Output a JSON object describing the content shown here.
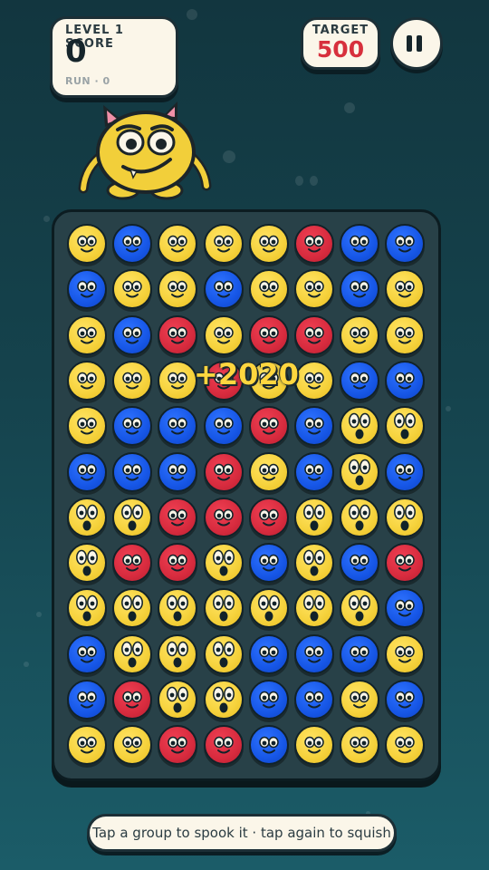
{
  "hud": {
    "score_label": "LEVEL 1 SCORE",
    "score": "0",
    "run": "RUN · 0",
    "target_label": "TARGET",
    "target": "500",
    "pause_icon": "pause-icon"
  },
  "popup": "+2020",
  "hint": "Tap a group to spook it · tap again to squish",
  "colors": {
    "yellow": "#f6d33e",
    "blue": "#1656e6",
    "red": "#d72b3e",
    "board": "#284148",
    "panel": "#fbf6e9",
    "target": "#d72b3e"
  },
  "board": {
    "rows": [
      [
        "Y",
        "B",
        "Y",
        "Y",
        "Y",
        "R",
        "B",
        "B"
      ],
      [
        "B",
        "Y",
        "Y",
        "B",
        "Y",
        "Y",
        "B",
        "Y"
      ],
      [
        "Y",
        "B",
        "R",
        "Y",
        "R",
        "R",
        "Y",
        "Y"
      ],
      [
        "Y",
        "Y",
        "Y",
        "R",
        "Y",
        "Y",
        "B",
        "B"
      ],
      [
        "Y",
        "B",
        "B",
        "B",
        "R",
        "B",
        "Ys",
        "Ys"
      ],
      [
        "B",
        "B",
        "B",
        "R",
        "Y",
        "B",
        "Ys",
        "B"
      ],
      [
        "Ys",
        "Ys",
        "R",
        "R",
        "R",
        "Ys",
        "Ys",
        "Ys"
      ],
      [
        "Ys",
        "R",
        "R",
        "Ys",
        "B",
        "Ys",
        "B",
        "R"
      ],
      [
        "Ys",
        "Ys",
        "Ys",
        "Ys",
        "Ys",
        "Ys",
        "Ys",
        "B"
      ],
      [
        "B",
        "Ys",
        "Ys",
        "Ys",
        "B",
        "B",
        "B",
        "Y"
      ],
      [
        "B",
        "R",
        "Ys",
        "Ys",
        "B",
        "B",
        "Y",
        "B"
      ],
      [
        "Y",
        "Y",
        "R",
        "R",
        "B",
        "Y",
        "Y",
        "Y"
      ]
    ]
  }
}
